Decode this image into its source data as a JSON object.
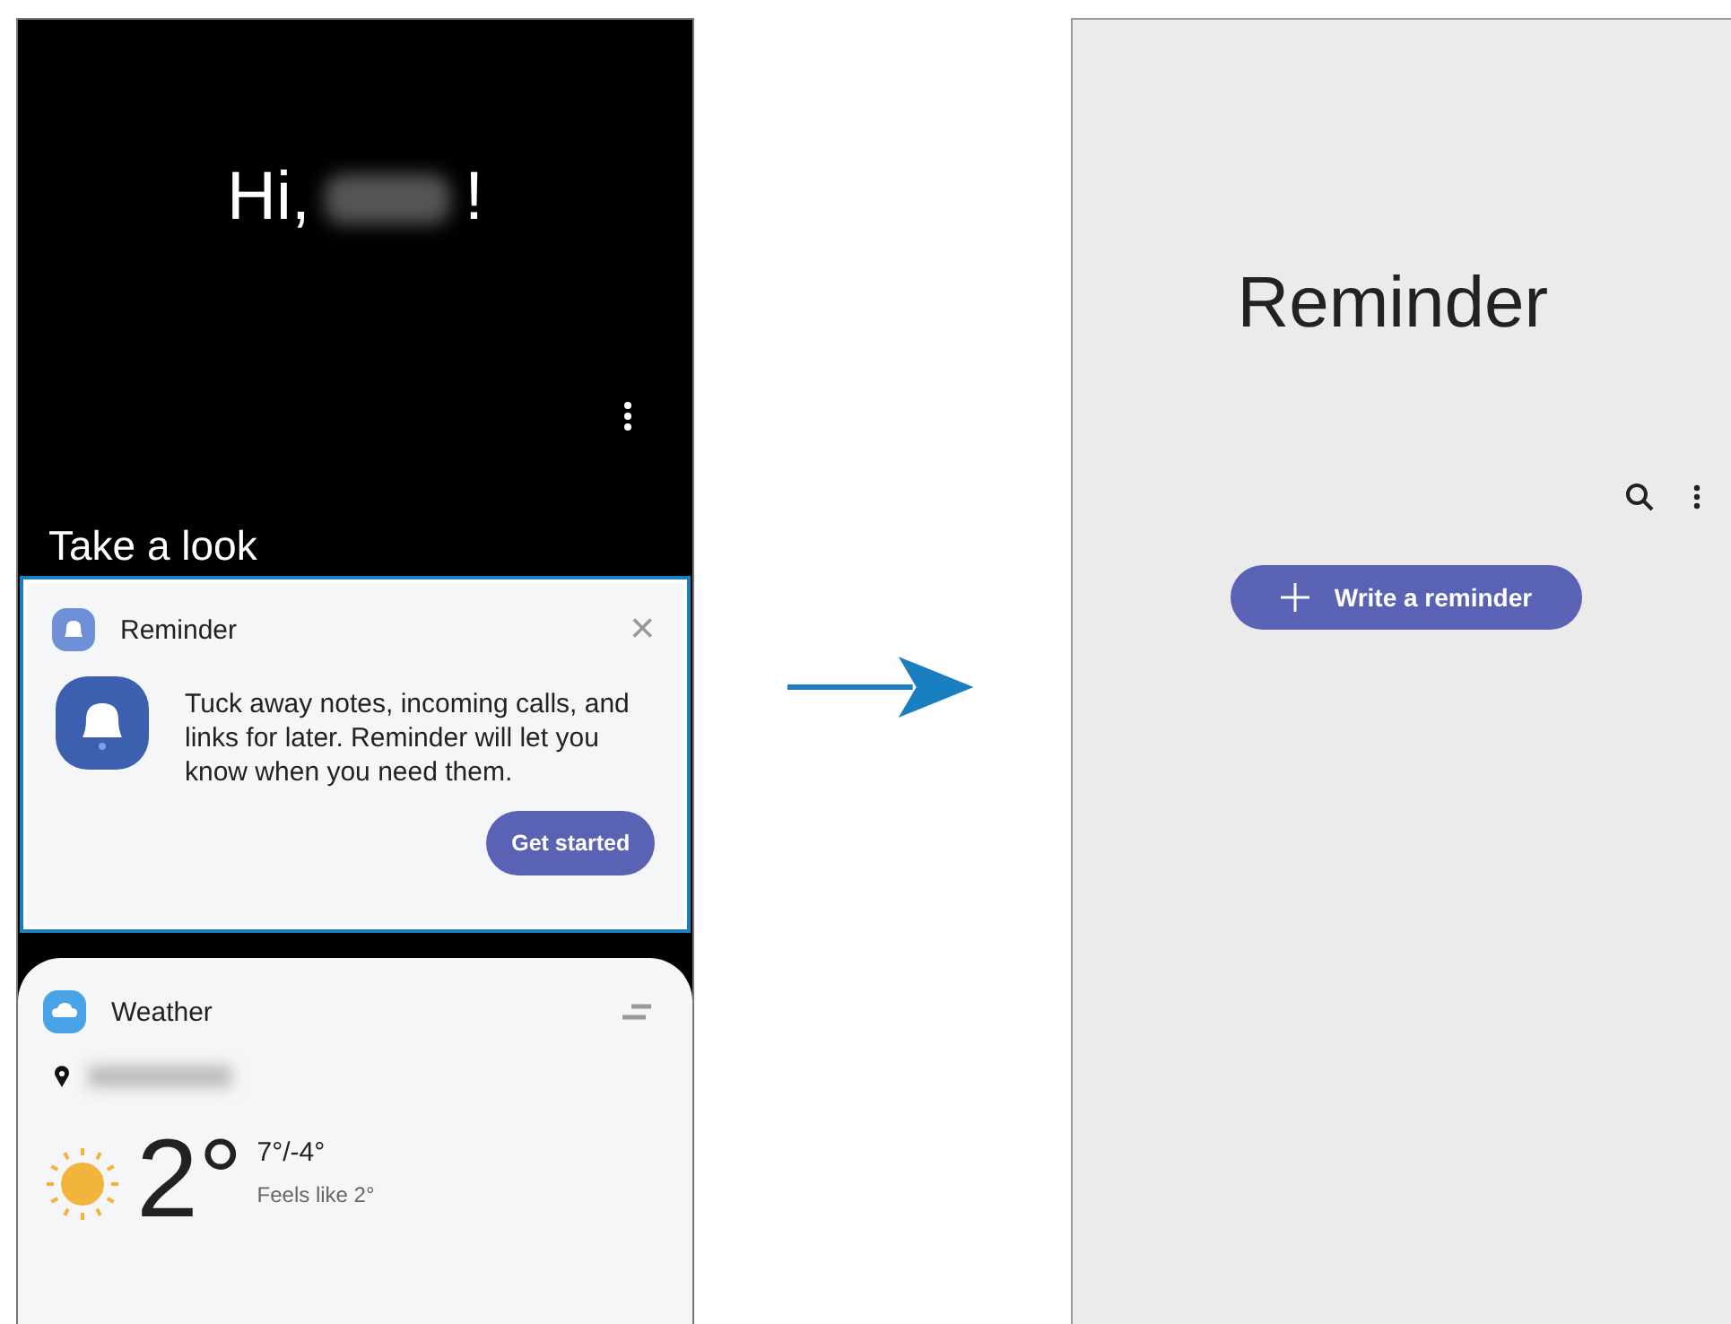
{
  "home_screen": {
    "greeting": "Hi,",
    "greeting_end": "!",
    "section_title": "Take a look",
    "cards": [
      {
        "kind": "reminder",
        "title": "Reminder",
        "highlighted": true,
        "description": "Tuck away notes, incoming calls, and links for later. Reminder will let you know when you need them.",
        "button": "Get started",
        "close": "×"
      },
      {
        "kind": "weather",
        "title": "Weather",
        "temperature": "2°",
        "high_low": "7°/-4°",
        "feels_like": "Feels like 2°"
      }
    ]
  },
  "reminder_screen": {
    "title": "Reminder",
    "button": "Write a reminder"
  }
}
